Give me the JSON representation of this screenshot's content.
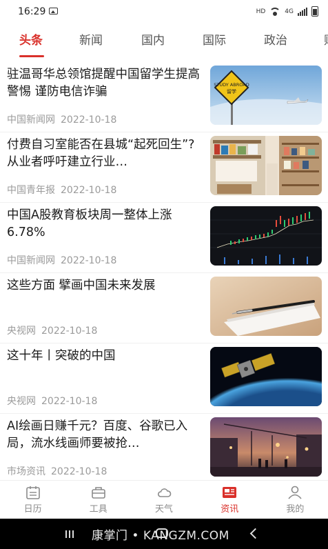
{
  "status_bar": {
    "time": "16:29",
    "network": "HD",
    "cell": "4G"
  },
  "tabs": [
    {
      "label": "头条",
      "active": true
    },
    {
      "label": "新闻",
      "active": false
    },
    {
      "label": "国内",
      "active": false
    },
    {
      "label": "国际",
      "active": false
    },
    {
      "label": "政治",
      "active": false
    },
    {
      "label": "财",
      "active": false
    }
  ],
  "news": [
    {
      "title": "驻温哥华总领馆提醒中国留学生提高警惕 谨防电信诈骗",
      "source": "中国新闻网",
      "date": "2022-10-18",
      "sign_text": "STUDY ABROAD",
      "sign_sub": "留学"
    },
    {
      "title": "付费自习室能否在县城“起死回生”?从业者呼吁建立行业…",
      "source": "中国青年报",
      "date": "2022-10-18"
    },
    {
      "title": "中国A股教育板块周一整体上涨6.78%",
      "source": "中国新闻网",
      "date": "2022-10-18"
    },
    {
      "title": "这些方面 擘画中国未来发展",
      "source": "央视网",
      "date": "2022-10-18"
    },
    {
      "title": "这十年丨突破的中国",
      "source": "央视网",
      "date": "2022-10-18"
    },
    {
      "title": "AI绘画日赚千元？百度、谷歌已入局，流水线画师要被抢…",
      "source": "市场资讯",
      "date": "2022-10-18"
    }
  ],
  "bottom_nav": [
    {
      "label": "日历",
      "icon": "calendar-icon",
      "active": false
    },
    {
      "label": "工具",
      "icon": "toolbox-icon",
      "active": false
    },
    {
      "label": "天气",
      "icon": "cloud-icon",
      "active": false
    },
    {
      "label": "资讯",
      "icon": "news-icon",
      "active": true
    },
    {
      "label": "我的",
      "icon": "user-icon",
      "active": false
    }
  ],
  "watermark": "康掌门 • KANGZM.COM",
  "colors": {
    "accent": "#d9302a",
    "text": "#1a1a1a",
    "meta": "#9a9a9a"
  }
}
